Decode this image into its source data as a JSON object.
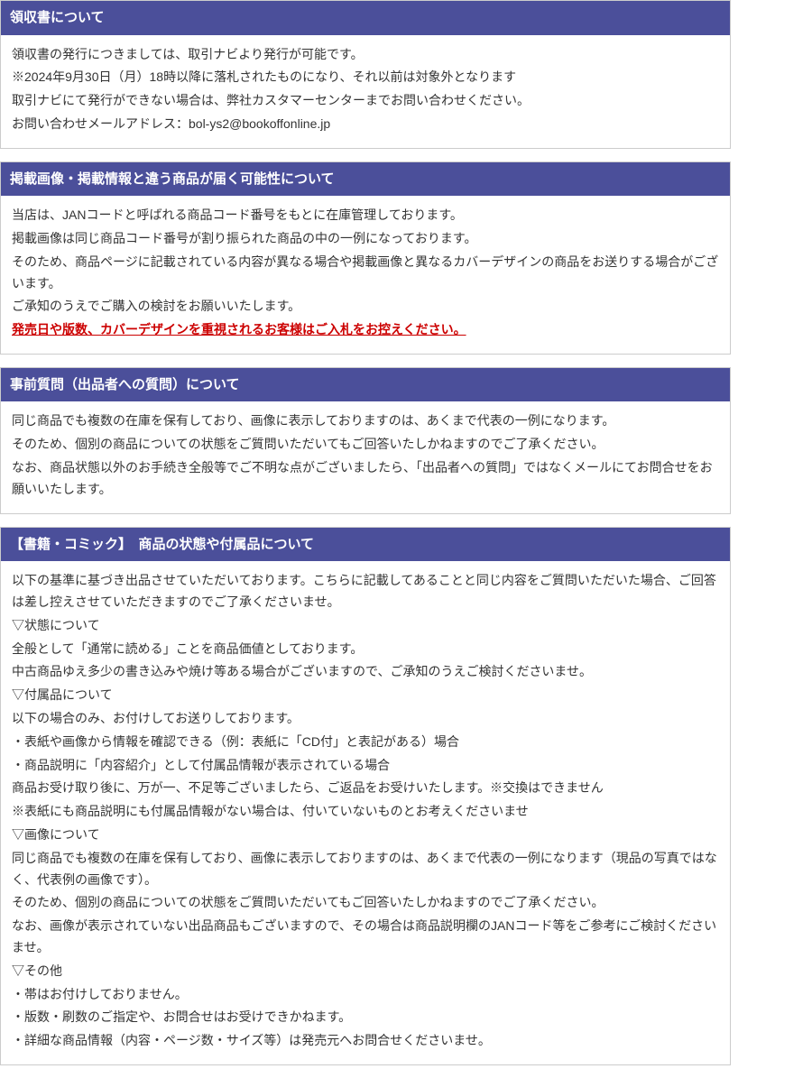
{
  "sections": {
    "receipt": {
      "title": "領収書について",
      "p1": "領収書の発行につきましては、取引ナビより発行が可能です。",
      "p2": "※2024年9月30日（月）18時以降に落札されたものになり、それ以前は対象外となります",
      "p3": "取引ナビにて発行ができない場合は、弊社カスタマーセンターまでお問い合わせください。",
      "p4": "お問い合わせメールアドレス：bol-ys2@bookoffonline.jp"
    },
    "different": {
      "title": "掲載画像・掲載情報と違う商品が届く可能性について",
      "p1": "当店は、JANコードと呼ばれる商品コード番号をもとに在庫管理しております。",
      "p2": "掲載画像は同じ商品コード番号が割り振られた商品の中の一例になっております。",
      "p3": "そのため、商品ページに記載されている内容が異なる場合や掲載画像と異なるカバーデザインの商品をお送りする場合がございます。",
      "p4": "ご承知のうえでご購入の検討をお願いいたします。",
      "p5": "発売日や版数、カバーデザインを重視されるお客様はご入札をお控えください。"
    },
    "question": {
      "title": "事前質問（出品者への質問）について",
      "p1": "同じ商品でも複数の在庫を保有しており、画像に表示しておりますのは、あくまで代表の一例になります。",
      "p2": "そのため、個別の商品についての状態をご質問いただいてもご回答いたしかねますのでご了承ください。",
      "p3": "なお、商品状態以外のお手続き全般等でご不明な点がございましたら、「出品者への質問」ではなくメールにてお問合せをお願いいたします。"
    },
    "books": {
      "title": "【書籍・コミック】　商品の状態や付属品について",
      "intro": "以下の基準に基づき出品させていただいております。こちらに記載してあることと同じ内容をご質問いただいた場合、ご回答は差し控えさせていただきますのでご了承くださいませ。",
      "condition_h": "▽状態について",
      "condition_p1": "全般として「通常に読める」ことを商品価値としております。",
      "condition_p2": "中古商品ゆえ多少の書き込みや焼け等ある場合がございますので、ご承知のうえご検討くださいませ。",
      "accessory_h": "▽付属品について",
      "accessory_p1": "以下の場合のみ、お付けしてお送りしております。",
      "accessory_p2": "・表紙や画像から情報を確認できる（例：表紙に「CD付」と表記がある）場合",
      "accessory_p3": "・商品説明に「内容紹介」として付属品情報が表示されている場合",
      "accessory_p4": "商品お受け取り後に、万が一、不足等ございましたら、ご返品をお受けいたします。※交換はできません",
      "accessory_p5": "※表紙にも商品説明にも付属品情報がない場合は、付いていないものとお考えくださいませ",
      "image_h": "▽画像について",
      "image_p1": "同じ商品でも複数の在庫を保有しており、画像に表示しておりますのは、あくまで代表の一例になります（現品の写真ではなく、代表例の画像です）。",
      "image_p2": "そのため、個別の商品についての状態をご質問いただいてもご回答いたしかねますのでご了承ください。",
      "image_p3": "なお、画像が表示されていない出品商品もございますので、その場合は商品説明欄のJANコード等をご参考にご検討くださいませ。",
      "other_h": "▽その他",
      "other_p1": "・帯はお付けしておりません。",
      "other_p2": "・版数・刷数のご指定や、お問合せはお受けできかねます。",
      "other_p3": "・詳細な商品情報（内容・ページ数・サイズ等）は発売元へお問合せくださいませ。"
    }
  }
}
